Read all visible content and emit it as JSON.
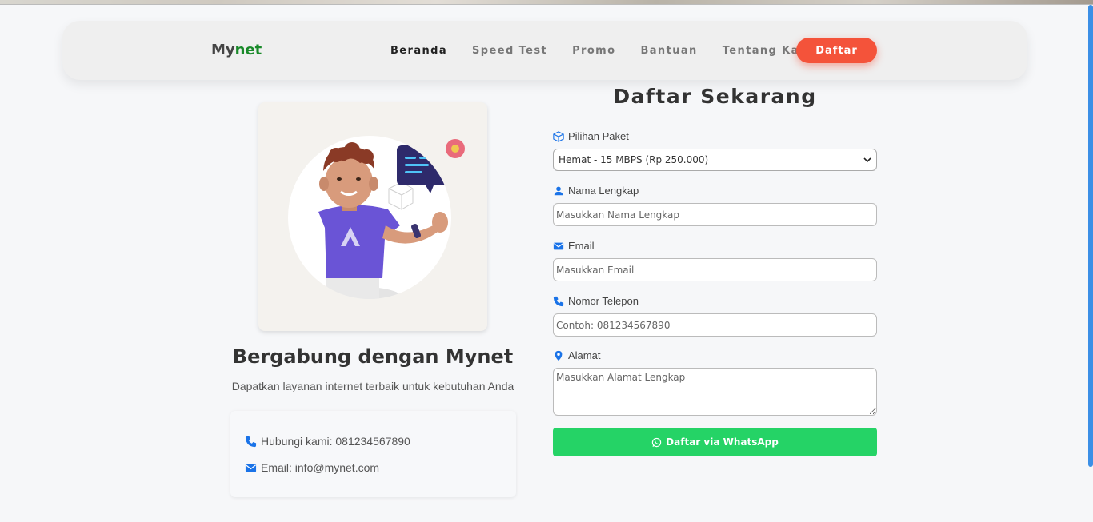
{
  "brand": {
    "logo_prefix": "My",
    "logo_accent": "net"
  },
  "nav": {
    "links": [
      "Beranda",
      "Speed Test",
      "Promo",
      "Bantuan",
      "Tentang Kami"
    ],
    "active": "Beranda",
    "cta_label": "Daftar"
  },
  "hero": {
    "title": "Bergabung dengan Mynet",
    "subtitle": "Dapatkan layanan internet terbaik untuk kebutuhan Anda",
    "contact_phone": "Hubungi kami: 081234567890",
    "contact_email": "Email: info@mynet.com"
  },
  "form": {
    "title": "Daftar Sekarang",
    "package_label": "Pilihan Paket",
    "package_value": "Hemat - 15 MBPS (Rp 250.000)",
    "name_label": "Nama Lengkap",
    "name_placeholder": "Masukkan Nama Lengkap",
    "email_label": "Email",
    "email_placeholder": "Masukkan Email",
    "phone_label": "Nomor Telepon",
    "phone_placeholder": "Contoh: 081234567890",
    "address_label": "Alamat",
    "address_placeholder": "Masukkan Alamat Lengkap",
    "submit_label": "Daftar via WhatsApp"
  },
  "colors": {
    "accent": "#f4533a",
    "brand_green": "#1a8a2a",
    "whatsapp": "#25d366",
    "icon_blue": "#1a73e8"
  },
  "icons": [
    "box-icon",
    "user-icon",
    "envelope-icon",
    "phone-icon",
    "map-pin-icon",
    "whatsapp-icon",
    "chevron-down-icon"
  ]
}
